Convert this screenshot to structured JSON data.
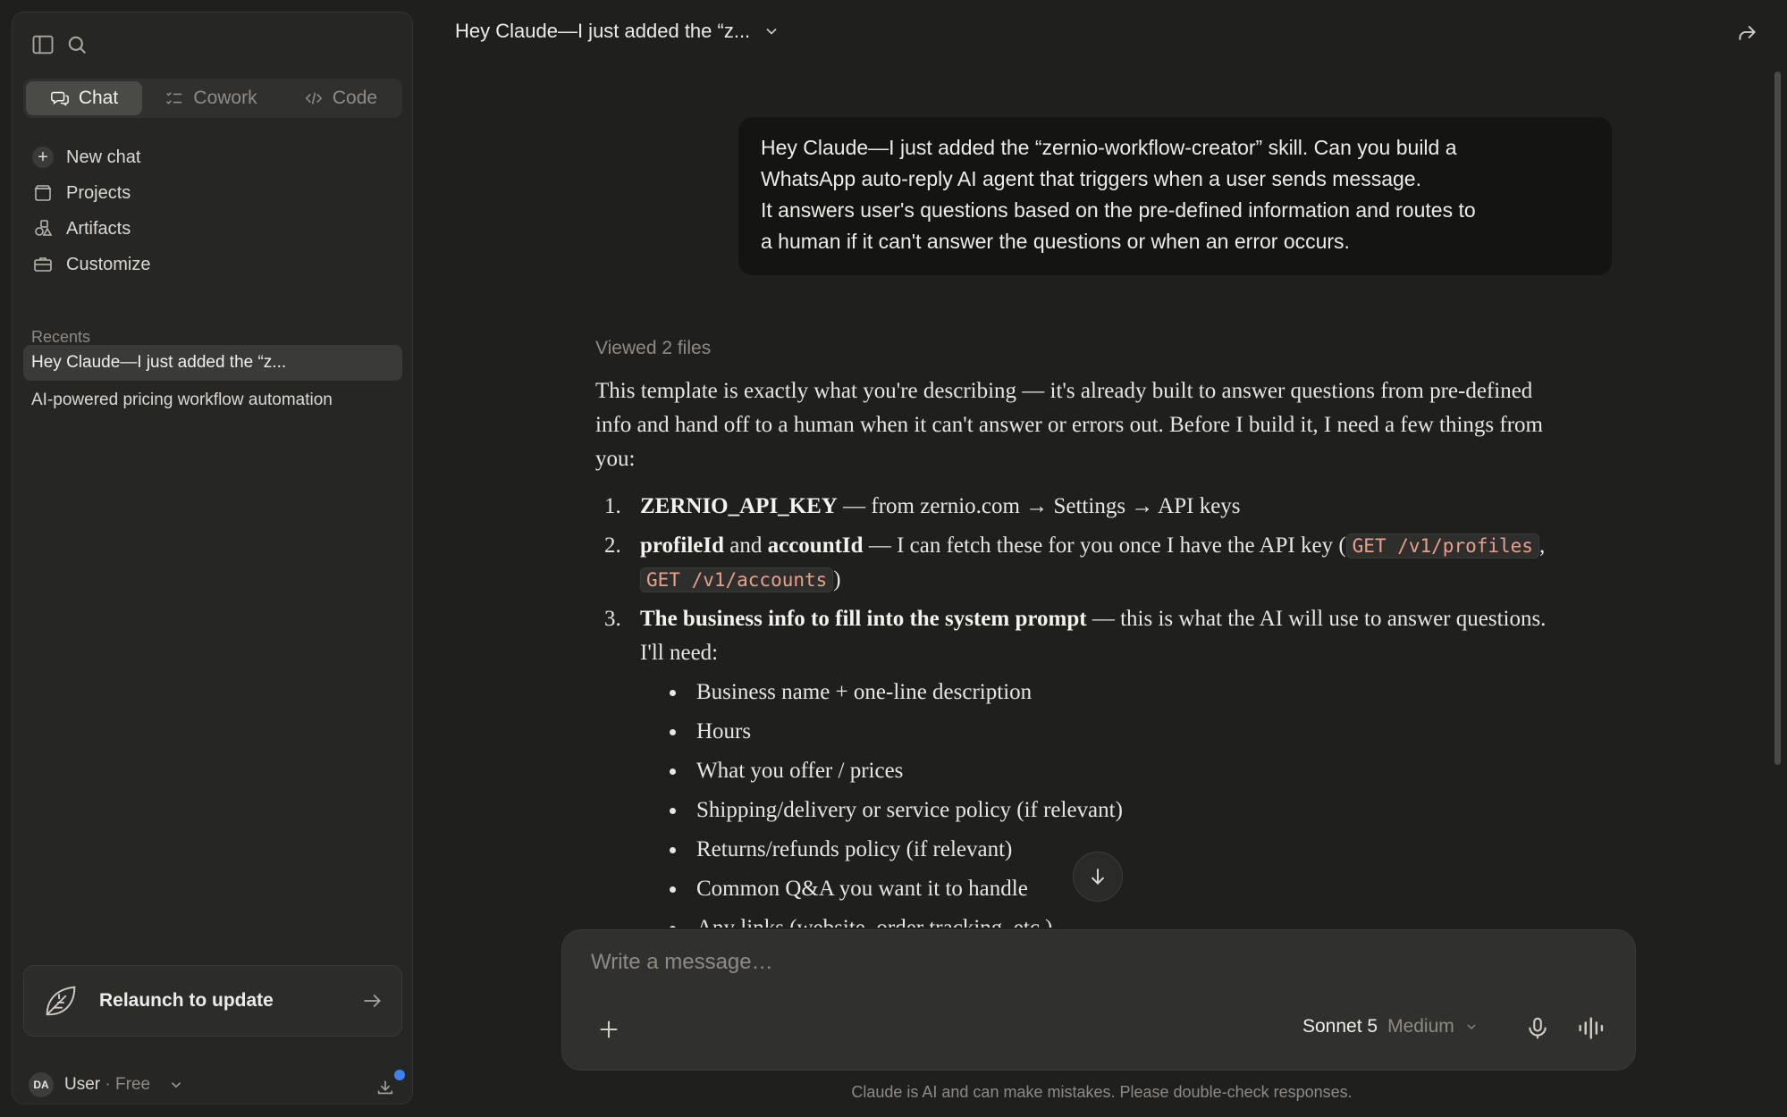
{
  "sidebar": {
    "modes": [
      {
        "label": "Chat",
        "icon": "chat-bubbles-icon"
      },
      {
        "label": "Cowork",
        "icon": "checklist-icon"
      },
      {
        "label": "Code",
        "icon": "code-brackets-icon"
      }
    ],
    "nav": [
      {
        "label": "New chat",
        "icon": "plus-icon"
      },
      {
        "label": "Projects",
        "icon": "folder-icon"
      },
      {
        "label": "Artifacts",
        "icon": "shapes-icon"
      },
      {
        "label": "Customize",
        "icon": "briefcase-icon"
      }
    ],
    "recents_label": "Recents",
    "recents": [
      "Hey Claude—I just added the “z...",
      "AI-powered pricing workflow automation"
    ],
    "update_label": "Relaunch to update",
    "user": {
      "initials": "DA",
      "name": "User",
      "separator": " · ",
      "plan": "Free"
    }
  },
  "header": {
    "title": "Hey Claude—I just added the “z..."
  },
  "user_message": "Hey Claude—I just added the “zernio-workflow-creator” skill. Can you build a\nWhatsApp auto-reply AI agent that triggers when a user sends message.\nIt answers user's questions based on the pre-defined information and routes to\na human if it can't answer the questions or when an error occurs.",
  "assistant": {
    "viewed_label": "Viewed 2 files",
    "intro": "This template is exactly what you're describing — it's already built to answer questions from pre-defined info and hand off to a human when it can't answer or errors out. Before I build it, I need a few things from you:",
    "steps": [
      {
        "num": "1.",
        "bold": "ZERNIO_API_KEY",
        "text": " — from zernio.com → Settings → API keys"
      },
      {
        "num": "2.",
        "bold1": "profileId",
        "and": " and ",
        "bold2": "accountId",
        "text": " — I can fetch these for you once I have the API key (",
        "code1": "GET /v1/profiles",
        "comma": ", ",
        "code2": "GET /v1/accounts",
        "close": ")"
      },
      {
        "num": "3.",
        "bold": "The business info to fill into the system prompt",
        "text": " — this is what the AI will use to answer questions. I'll need:"
      }
    ],
    "bullets": [
      "Business name + one-line description",
      "Hours",
      "What you offer / prices",
      "Shipping/delivery or service policy (if relevant)",
      "Returns/refunds policy (if relevant)",
      "Common Q&A you want it to handle",
      "Any links (website, order tracking, etc.)"
    ]
  },
  "composer": {
    "placeholder": "Write a message…",
    "model": "Sonnet 5",
    "effort": "Medium"
  },
  "disclaimer": "Claude is AI and can make mistakes. Please double-check responses."
}
